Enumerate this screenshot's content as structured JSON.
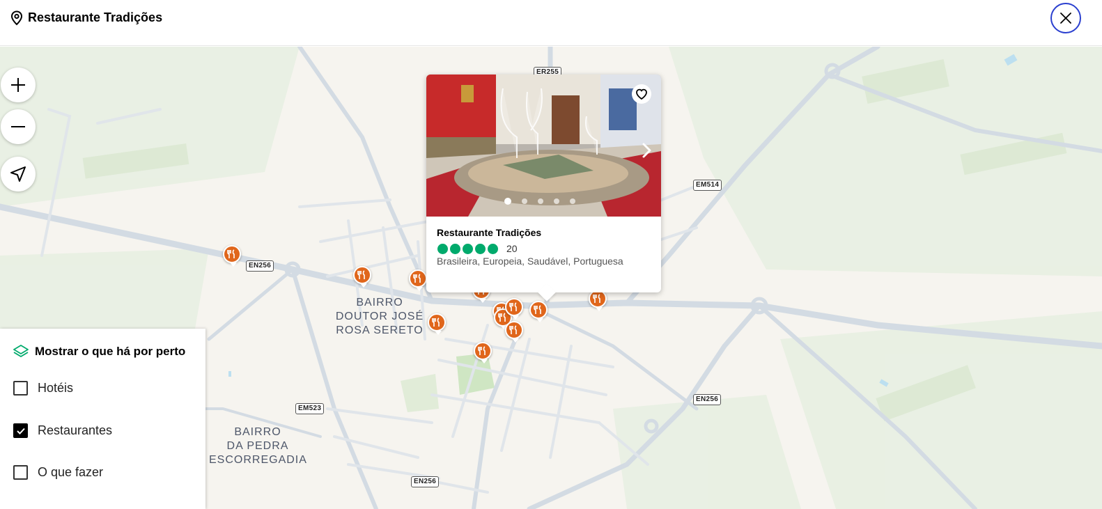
{
  "header": {
    "title": "Restaurante Tradições",
    "pin_icon": "location-pin-icon",
    "close_icon": "close-icon",
    "accent_color": "#2a3fcf"
  },
  "map_controls": {
    "zoom_in_icon": "plus-icon",
    "zoom_out_icon": "minus-icon",
    "locate_icon": "navigation-arrow-icon"
  },
  "road_labels": [
    "ER255",
    "EM514",
    "EN256",
    "EM523",
    "EN256",
    "EN256"
  ],
  "area_labels": [
    "BAIRRO\nDOUTOR JOSÉ\nROSA SERETO",
    "BAIRRO\nDA PEDRA\nESCORREGADIA"
  ],
  "popup": {
    "name": "Restaurante Tradições",
    "rating_bubbles": 5,
    "review_count": "20",
    "cuisine": "Brasileira, Europeia, Saudável, Portuguesa",
    "photo_count": 5,
    "active_photo": 1,
    "rating_color": "#00aa6c",
    "favorite_icon": "heart-icon",
    "next_icon": "chevron-right-icon"
  },
  "poi": {
    "color": "#e0661b",
    "icon": "fork-knife-icon"
  },
  "nearby_panel": {
    "title": "Mostrar o que há por perto",
    "icon": "layers-icon",
    "options": [
      {
        "label": "Hotéis",
        "checked": false
      },
      {
        "label": "Restaurantes",
        "checked": true
      },
      {
        "label": "O que fazer",
        "checked": false
      }
    ]
  }
}
